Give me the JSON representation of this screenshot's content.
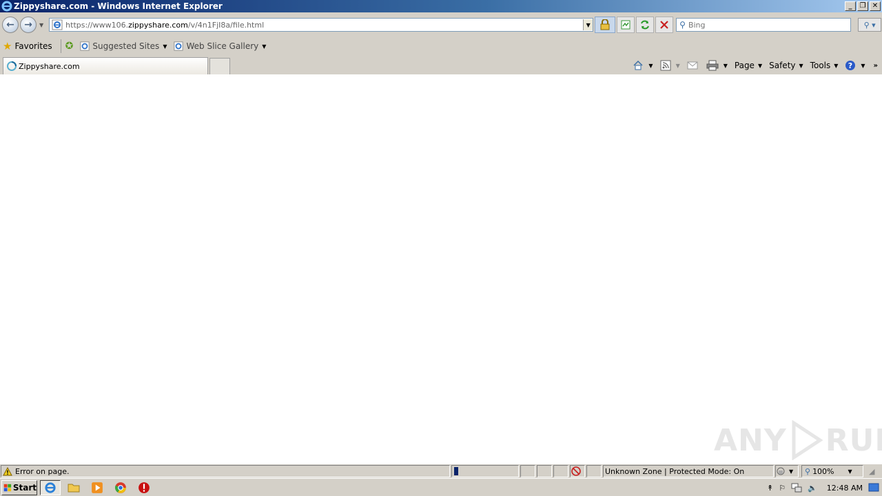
{
  "window": {
    "title": "Zippyshare.com - Windows Internet Explorer",
    "buttons": [
      "_",
      "❐",
      "✕"
    ]
  },
  "navbar": {
    "url_scheme": "https://",
    "url_host_prefix": "www106.",
    "url_domain": "zippyshare.com",
    "url_path": "/v/4n1FjI8a/file.html",
    "search_placeholder": "Bing"
  },
  "favorites": {
    "favorites_label": "Favorites",
    "links": [
      {
        "label": "Suggested Sites"
      },
      {
        "label": "Web Slice Gallery"
      }
    ]
  },
  "tabs": {
    "active_tab": "Zippyshare.com"
  },
  "commands": {
    "page": "Page",
    "safety": "Safety",
    "tools": "Tools"
  },
  "watermark": {
    "left": "ANY",
    "right": "RUN"
  },
  "statusbar": {
    "message": "Error on page.",
    "zone": "Unknown Zone | Protected Mode: On",
    "zoom": "100%"
  },
  "taskbar": {
    "start": "Start",
    "clock": "12:48 AM"
  }
}
